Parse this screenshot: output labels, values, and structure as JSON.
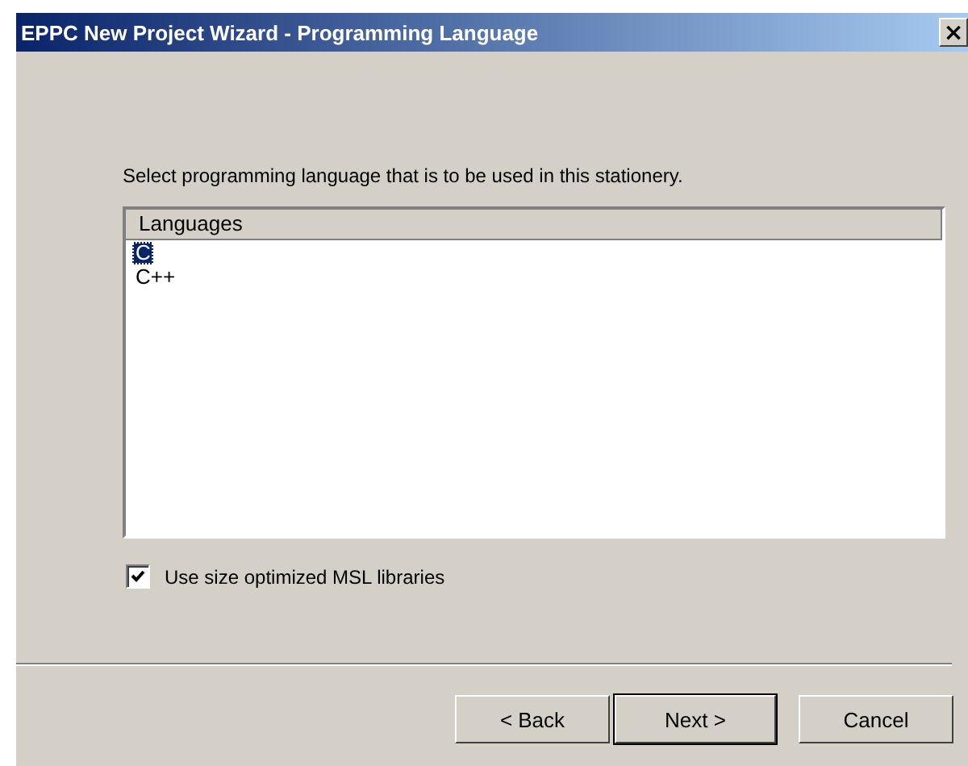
{
  "window": {
    "title": "EPPC New Project Wizard - Programming Language",
    "close": "×"
  },
  "prompt": "Select programming language that is to be used in this stationery.",
  "list": {
    "header": "Languages",
    "items": [
      {
        "label": "C",
        "selected": true
      },
      {
        "label": "C++",
        "selected": false
      }
    ]
  },
  "option": {
    "label": "Use size optimized MSL libraries",
    "checked": true
  },
  "buttons": [
    {
      "label": "< Back",
      "default": false
    },
    {
      "label": "Next >",
      "default": true
    },
    {
      "label": "Cancel",
      "default": false
    }
  ]
}
